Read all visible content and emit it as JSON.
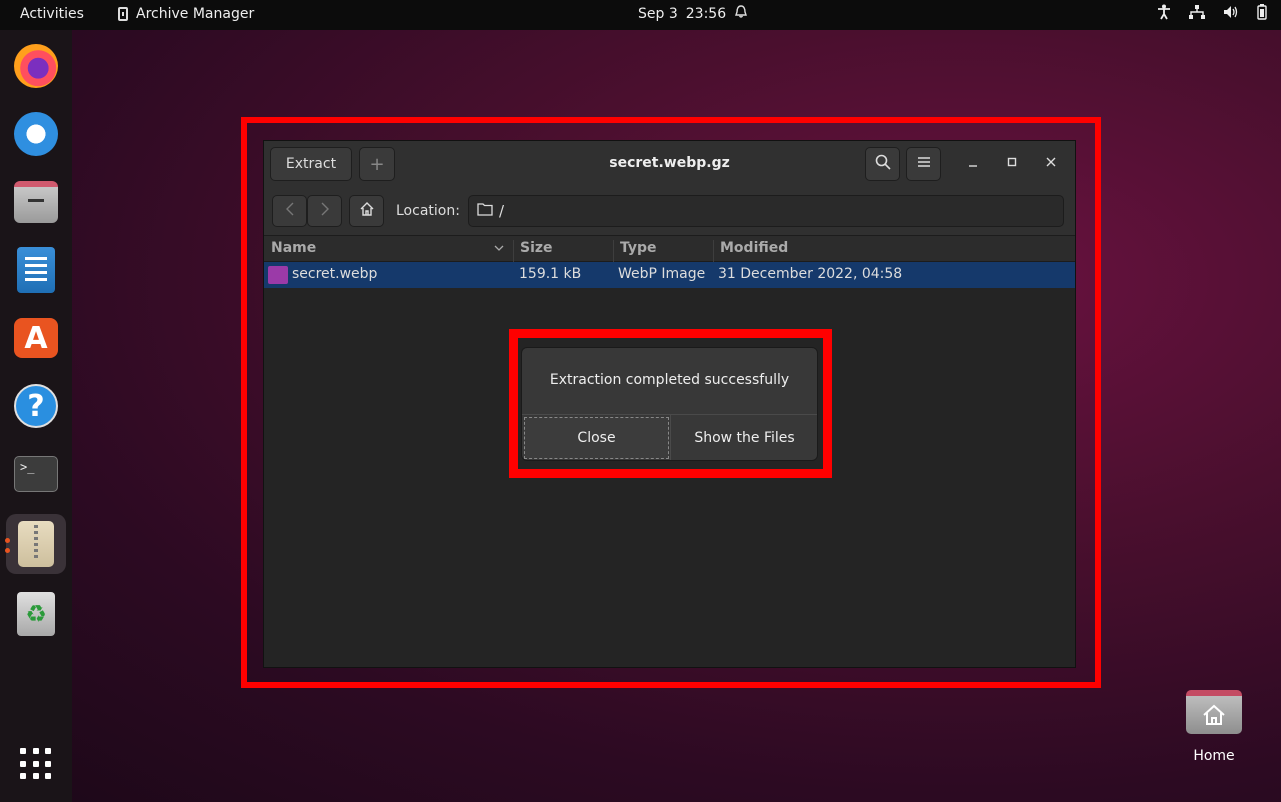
{
  "topbar": {
    "activities": "Activities",
    "app_name": "Archive Manager",
    "date": "Sep 3",
    "time": "23:56"
  },
  "dock": {
    "items": [
      "Firefox",
      "Thunderbird",
      "Files",
      "LibreOffice Writer",
      "Ubuntu Software",
      "Help",
      "Terminal",
      "Archive Manager",
      "Trash",
      "Show Applications"
    ],
    "terminal_prompt": ">_"
  },
  "window": {
    "title": "secret.webp.gz",
    "extract_label": "Extract",
    "add_label": "+",
    "location_label": "Location:",
    "location_path": "/",
    "columns": [
      "Name",
      "Size",
      "Type",
      "Modified"
    ],
    "rows": [
      {
        "name": "secret.webp",
        "size": "159.1 kB",
        "type": "WebP Image",
        "modified": "31 December 2022, 04:58"
      }
    ]
  },
  "dialog": {
    "message": "Extraction completed successfully",
    "close_label": "Close",
    "show_files_label": "Show the Files"
  },
  "desktop": {
    "home_label": "Home"
  },
  "colors": {
    "highlight_frame": "#ff0000",
    "selection": "#15396b",
    "ubuntu_orange": "#e95420"
  }
}
